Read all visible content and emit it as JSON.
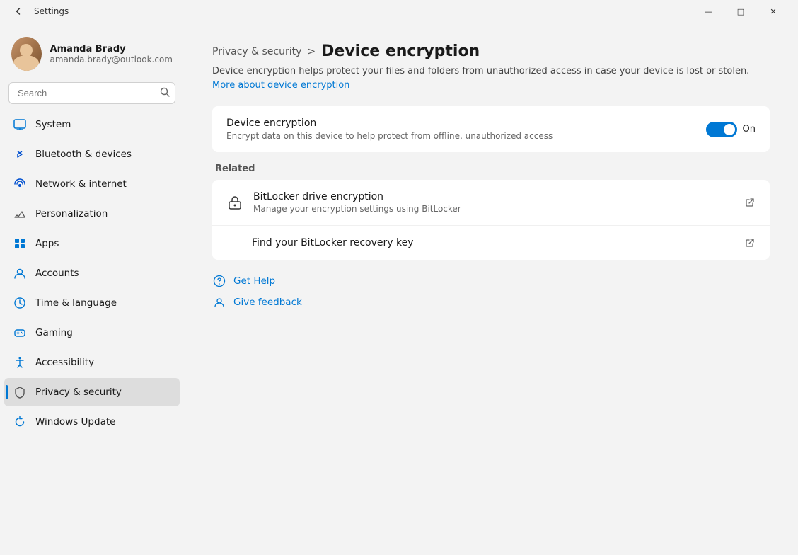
{
  "window": {
    "title": "Settings",
    "minimize_label": "—",
    "maximize_label": "□",
    "close_label": "✕"
  },
  "user": {
    "name": "Amanda Brady",
    "email": "amanda.brady@outlook.com"
  },
  "search": {
    "placeholder": "Search"
  },
  "nav": {
    "items": [
      {
        "id": "system",
        "label": "System"
      },
      {
        "id": "bluetooth",
        "label": "Bluetooth & devices"
      },
      {
        "id": "network",
        "label": "Network & internet"
      },
      {
        "id": "personalization",
        "label": "Personalization"
      },
      {
        "id": "apps",
        "label": "Apps"
      },
      {
        "id": "accounts",
        "label": "Accounts"
      },
      {
        "id": "time",
        "label": "Time & language"
      },
      {
        "id": "gaming",
        "label": "Gaming"
      },
      {
        "id": "accessibility",
        "label": "Accessibility"
      },
      {
        "id": "privacy",
        "label": "Privacy & security"
      },
      {
        "id": "update",
        "label": "Windows Update"
      }
    ]
  },
  "breadcrumb": {
    "parent": "Privacy & security",
    "separator": ">",
    "current": "Device encryption"
  },
  "content": {
    "description": "Device encryption helps protect your files and folders from unauthorized access in case your device is lost or stolen.",
    "description_link": "More about device encryption",
    "device_encryption": {
      "title": "Device encryption",
      "desc": "Encrypt data on this device to help protect from offline, unauthorized access",
      "toggle_state": "On",
      "toggle_on": true
    },
    "related_section": "Related",
    "related_items": [
      {
        "title": "BitLocker drive encryption",
        "desc": "Manage your encryption settings using BitLocker",
        "external": true
      },
      {
        "title": "Find your BitLocker recovery key",
        "desc": "",
        "external": true
      }
    ],
    "help": {
      "get_help_label": "Get Help",
      "give_feedback_label": "Give feedback"
    }
  }
}
